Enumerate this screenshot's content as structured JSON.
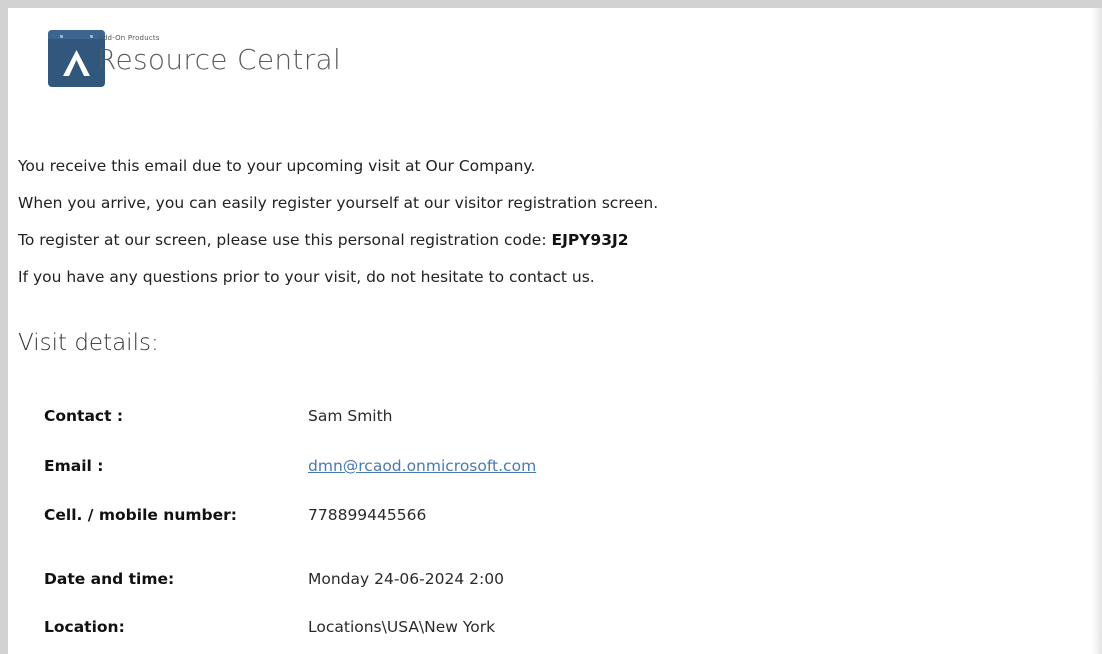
{
  "header": {
    "small_label": "Add-On Products",
    "title": "Resource Central",
    "logo_icon": "resource-central-logo-icon"
  },
  "intro": {
    "line1": "You receive this email due to your upcoming visit at Our Company.",
    "line2": "When you arrive, you can easily register yourself at our visitor registration screen.",
    "line3_prefix": "To register at our screen, please use this personal registration code: ",
    "registration_code": "EJPY93J2",
    "line4": "If you have any questions prior to your visit, do not hesitate to contact us."
  },
  "visit": {
    "title": "Visit details:",
    "contact_label": "Contact :",
    "contact_value": "Sam Smith",
    "email_label": "Email :",
    "email_value": "dmn@rcaod.onmicrosoft.com",
    "mobile_label": "Cell. / mobile number:",
    "mobile_value": "778899445566",
    "datetime_label": "Date and time:",
    "datetime_value": "Monday 24-06-2024 2:00",
    "location_label": "Location:",
    "location_value": "Locations\\USA\\New York"
  },
  "colors": {
    "logo_bg": "#31577d",
    "link": "#4a7ab0"
  }
}
